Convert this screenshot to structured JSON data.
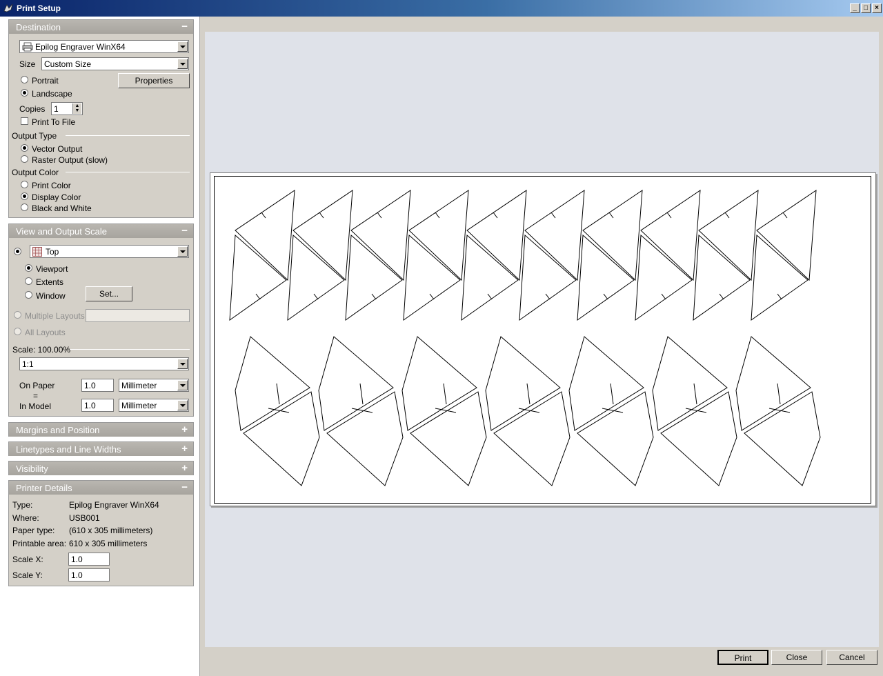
{
  "window": {
    "title": "Print Setup"
  },
  "destination": {
    "header": "Destination",
    "toggle": "−",
    "printer": "Epilog Engraver WinX64",
    "size_label": "Size",
    "size_value": "Custom Size",
    "portrait": "Portrait",
    "landscape": "Landscape",
    "properties": "Properties",
    "copies_label": "Copies",
    "copies_value": "1",
    "print_to_file": "Print To File",
    "output_type_label": "Output Type",
    "vector_output": "Vector Output",
    "raster_output": "Raster Output (slow)",
    "output_color_label": "Output Color",
    "print_color": "Print Color",
    "display_color": "Display Color",
    "black_white": "Black and White"
  },
  "view_scale": {
    "header": "View and Output Scale",
    "toggle": "−",
    "view": "Top",
    "viewport": "Viewport",
    "extents": "Extents",
    "window": "Window",
    "set_button": "Set...",
    "multiple_layouts": "Multiple Layouts",
    "all_layouts": "All Layouts",
    "scale_label": "Scale:  100.00%",
    "scale_ratio": "1:1",
    "on_paper_label": "On Paper",
    "on_paper_value": "1.0",
    "on_paper_unit": "Millimeter",
    "equals": "=",
    "in_model_label": "In Model",
    "in_model_value": "1.0",
    "in_model_unit": "Millimeter"
  },
  "collapsed_sections": [
    {
      "label": "Margins and Position",
      "toggle": "+"
    },
    {
      "label": "Linetypes and Line Widths",
      "toggle": "+"
    },
    {
      "label": "Visibility",
      "toggle": "+"
    }
  ],
  "printer_details": {
    "header": "Printer Details",
    "toggle": "−",
    "type_label": "Type:",
    "type_value": "Epilog Engraver WinX64",
    "where_label": "Where:",
    "where_value": "USB001",
    "paper_type_label": "Paper type:",
    "paper_type_value": "(610 x 305 millimeters)",
    "printable_label": "Printable area:",
    "printable_value": "610 x 305 millimeters",
    "scale_x_label": "Scale X:",
    "scale_x_value": "1.0",
    "scale_y_label": "Scale Y:",
    "scale_y_value": "1.0"
  },
  "buttons": {
    "print": "Print",
    "close": "Close",
    "cancel": "Cancel"
  }
}
